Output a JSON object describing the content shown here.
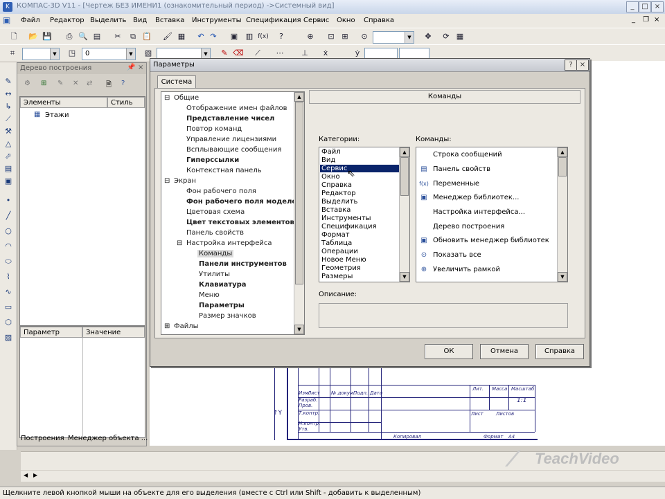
{
  "window": {
    "title": "КОМПАС-3D V11 - [Чертеж БЕЗ ИМЕНИ1 (ознакомительный период) ->Системный вид]"
  },
  "menu": [
    "Файл",
    "Редактор",
    "Выделить",
    "Вид",
    "Вставка",
    "Инструменты",
    "Спецификация",
    "Сервис",
    "Окно",
    "Справка"
  ],
  "toolbar2": {
    "layer_value": "0"
  },
  "tree_panel": {
    "title": "Дерево построения",
    "col_elements": "Элементы",
    "col_style": "Стиль",
    "row_floors": "Этажи",
    "col_param": "Параметр",
    "col_value": "Значение",
    "tab_build": "Построения",
    "tab_manager": "Менеджер объекта ..."
  },
  "dialog": {
    "title": "Параметры",
    "help_btn": "?",
    "close_btn": "×",
    "tab_system": "Система",
    "tree": {
      "general": "Общие",
      "general_items": [
        "Отображение имен файлов",
        "Представление чисел",
        "Повтор команд",
        "Управление лицензиями",
        "Всплывающие сообщения",
        "Гиперссылки",
        "Контекстная панель"
      ],
      "screen": "Экран",
      "screen_items": [
        "Фон рабочего поля",
        "Фон рабочего поля моделей",
        "Цветовая схема",
        "Цвет текстовых элементов",
        "Панель свойств"
      ],
      "interface": "Настройка интерфейса",
      "interface_items": [
        "Команды",
        "Панели инструментов",
        "Утилиты",
        "Клавиатура",
        "Меню",
        "Параметры",
        "Размер значков"
      ],
      "files": "Файлы"
    },
    "section_header": "Команды",
    "categories_label": "Категории:",
    "categories": [
      "Файл",
      "Вид",
      "Сервис",
      "Окно",
      "Справка",
      "Редактор",
      "Выделить",
      "Вставка",
      "Инструменты",
      "Спецификация",
      "Формат",
      "Таблица",
      "Операции",
      "Новое Меню",
      "Геометрия",
      "Размеры"
    ],
    "selected_category": "Сервис",
    "commands_label": "Команды:",
    "commands": [
      {
        "label": "Строка сообщений",
        "icon": ""
      },
      {
        "label": "Панель свойств",
        "icon": "panel-icon"
      },
      {
        "label": "Переменные",
        "icon": "fx-icon"
      },
      {
        "label": "Менеджер библиотек...",
        "icon": "library-icon"
      },
      {
        "label": "Настройка интерфейса...",
        "icon": ""
      },
      {
        "label": "Дерево построения",
        "icon": ""
      },
      {
        "label": "Обновить менеджер библиотек",
        "icon": "refresh-library-icon"
      },
      {
        "label": "Показать все",
        "icon": "zoom-all-icon"
      },
      {
        "label": "Увеличить рамкой",
        "icon": "zoom-frame-icon"
      }
    ],
    "description_label": "Описание:",
    "ok": "ОК",
    "cancel": "Отмена",
    "help": "Справка"
  },
  "stamp": {
    "izm": "Изм.",
    "list": "Лист",
    "ndoc": "№ докум.",
    "podp": "Подп.",
    "data": "Дата",
    "razrab": "Разраб.",
    "prov": "Пров.",
    "tkontr": "Т.контр.",
    "nkontr": "Н.контр.",
    "utv": "Утв.",
    "lit": "Лит.",
    "massa": "Масса",
    "masshtab": "Масштаб",
    "scale_value": "1:1",
    "list2": "Лист",
    "listov": "Листов",
    "kopiroval": "Копировал",
    "format": "Формат",
    "format_value": "A4"
  },
  "status": {
    "text": "Щелкните левой кнопкой мыши на объекте для его выделения (вместе с Ctrl или Shift - добавить к выделенным)"
  },
  "watermark": {
    "text": "TeachVideo"
  }
}
